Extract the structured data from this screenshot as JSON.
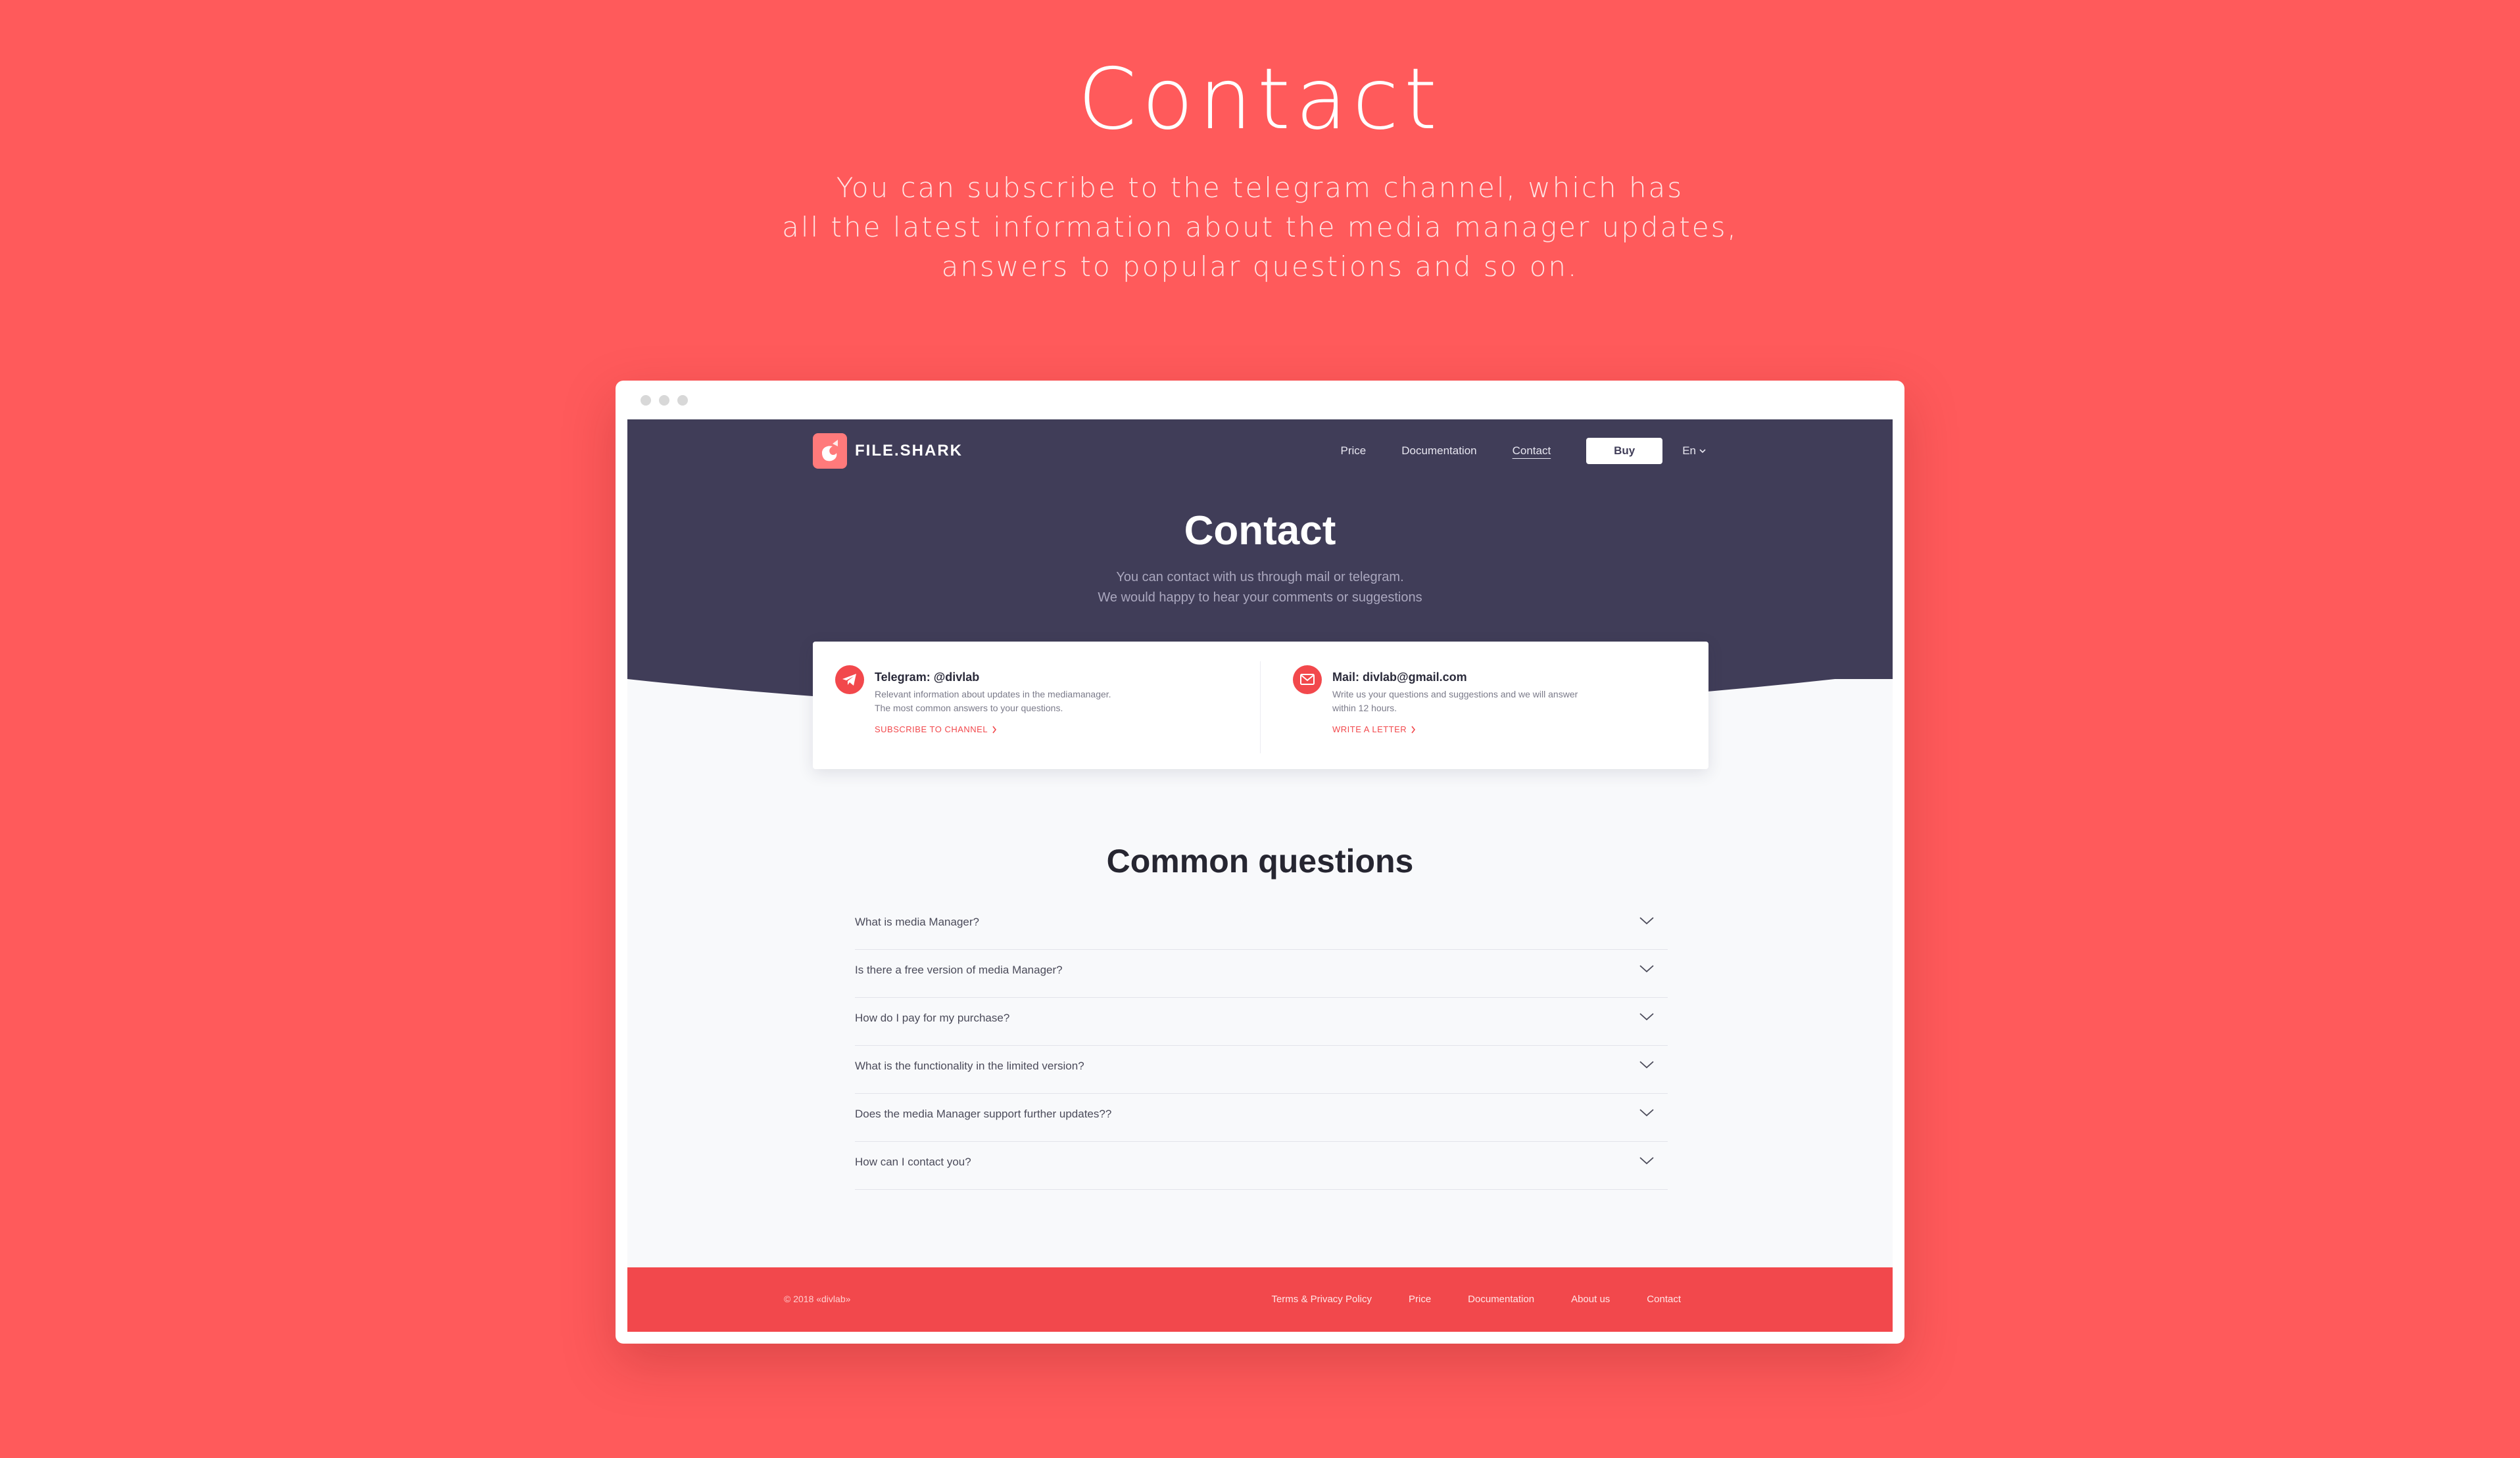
{
  "promo": {
    "title": "Contact",
    "lines": [
      "You can subscribe to the telegram channel, which has",
      "all the latest information about the media manager updates,",
      "answers to popular questions and so on."
    ]
  },
  "nav": {
    "brand": "FILE.SHARK",
    "links": [
      "Price",
      "Documentation",
      "Contact"
    ],
    "buy_label": "Buy",
    "lang": "En"
  },
  "hero": {
    "title": "Contact",
    "sub": [
      "You can contact with us through mail or telegram.",
      "We would happy to hear your comments or suggestions"
    ]
  },
  "contacts": {
    "telegram": {
      "title": "Telegram: @divlab",
      "desc": [
        "Relevant information about updates in the mediamanager.",
        "The most common answers to your questions."
      ],
      "link": "SUBSCRIBE TO CHANNEL"
    },
    "mail": {
      "title": "Mail: divlab@gmail.com",
      "desc": [
        "Write us your questions and suggestions and we will answer",
        "within 12 hours."
      ],
      "link": "WRITE A LETTER"
    }
  },
  "faq": {
    "title": "Common questions",
    "questions": [
      "What is media Manager?",
      "Is there a free version of media Manager?",
      "How do I pay for my purchase?",
      "What is the functionality in the limited version?",
      "Does the media Manager support further updates??",
      "How can I contact you?"
    ]
  },
  "footer": {
    "copyright": "© 2018 «divlab»",
    "links": [
      "Terms & Privacy Policy",
      "Price",
      "Documentation",
      "About us",
      "Contact"
    ]
  },
  "colors": {
    "background": "#ff5a5b",
    "hero": "#403d58",
    "accent": "#f2484c",
    "page": "#f8f9fb"
  },
  "icons": [
    "telegram-icon",
    "mail-icon",
    "chevron-down-icon",
    "chevron-right-icon",
    "shark-logo-icon"
  ]
}
